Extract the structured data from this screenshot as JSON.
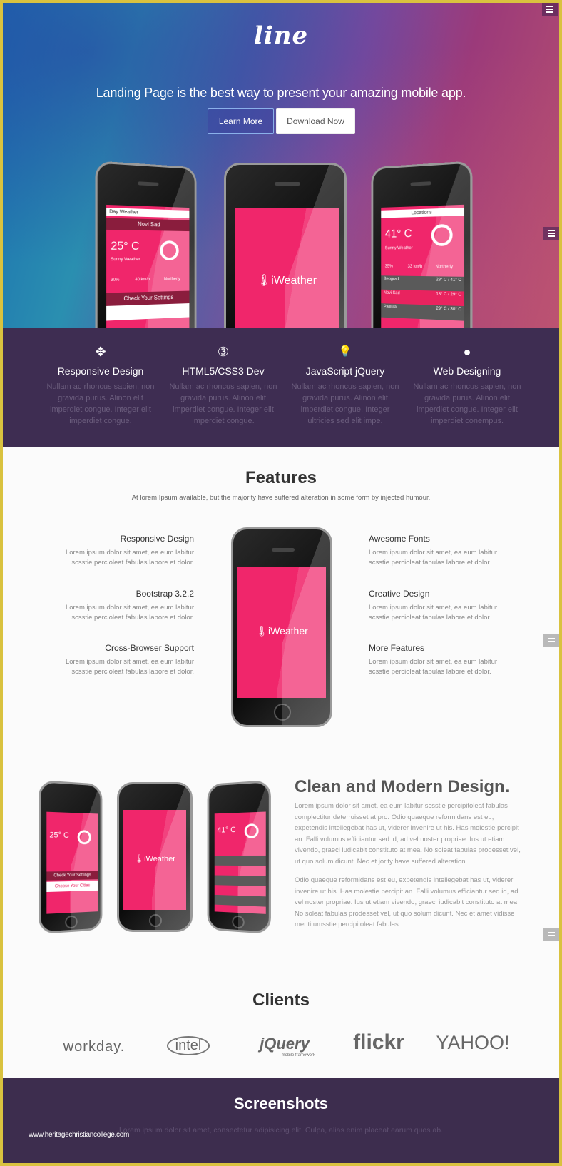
{
  "hero": {
    "logo": "line",
    "tagline": "Landing Page is the best way to present your amazing mobile app.",
    "learn_more": "Learn More",
    "download_now": "Download Now",
    "phones": {
      "left": {
        "app_title": "Day Weather",
        "city": "Novi Sad",
        "temp": "25° C",
        "condition": "Sunny Weather",
        "stats": [
          "30%",
          "40 km/h",
          "Northerly"
        ],
        "settings": "Check Your Settings"
      },
      "center": {
        "brand": "iWeather"
      },
      "right": {
        "app_title": "Locations",
        "temp": "41° C",
        "condition": "Sunny Weather",
        "stats": [
          "35%",
          "33 km/h",
          "Northerly"
        ],
        "rows": [
          {
            "city": "Beograd",
            "range": "28° C / 41° C"
          },
          {
            "city": "Novi Sad",
            "range": "18° C / 29° C"
          },
          {
            "city": "Palilula",
            "range": "29° C / 30° C"
          }
        ]
      }
    }
  },
  "services": [
    {
      "icon": "arrows-move-icon",
      "glyph": "✥",
      "title": "Responsive Design",
      "desc": "Nullam ac rhoncus sapien, non gravida purus. Alinon elit imperdiet congue. Integer elit imperdiet congue."
    },
    {
      "icon": "css3-icon",
      "glyph": "③",
      "title": "HTML5/CSS3 Dev",
      "desc": "Nullam ac rhoncus sapien, non gravida purus. Alinon elit imperdiet congue. Integer elit imperdiet congue."
    },
    {
      "icon": "lightbulb-icon",
      "glyph": "💡",
      "title": "JavaScript jQuery",
      "desc": "Nullam ac rhoncus sapien, non gravida purus. Alinon elit imperdiet congue. Integer ultricies sed elit impe."
    },
    {
      "icon": "globe-icon",
      "glyph": "●",
      "title": "Web Designing",
      "desc": "Nullam ac rhoncus sapien, non gravida purus. Alinon elit imperdiet congue. Integer elit imperdiet conempus."
    }
  ],
  "features": {
    "title": "Features",
    "subtitle": "At lorem Ipsum available, but the majority have suffered alteration in some form by injected humour.",
    "left": [
      {
        "title": "Responsive Design",
        "desc": "Lorem ipsum dolor sit amet, ea eum labitur scsstie percioleat fabulas labore et dolor."
      },
      {
        "title": "Bootstrap 3.2.2",
        "desc": "Lorem ipsum dolor sit amet, ea eum labitur scsstie percioleat fabulas labore et dolor."
      },
      {
        "title": "Cross-Browser Support",
        "desc": "Lorem ipsum dolor sit amet, ea eum labitur scsstie percioleat fabulas labore et dolor."
      }
    ],
    "right": [
      {
        "title": "Awesome Fonts",
        "desc": "Lorem ipsum dolor sit amet, ea eum labitur scsstie percioleat fabulas labore et dolor."
      },
      {
        "title": "Creative Design",
        "desc": "Lorem ipsum dolor sit amet, ea eum labitur scsstie percioleat fabulas labore et dolor."
      },
      {
        "title": "More Features",
        "desc": "Lorem ipsum dolor sit amet, ea eum labitur scsstie percioleat fabulas labore et dolor."
      }
    ],
    "phone_brand": "iWeather"
  },
  "modern": {
    "title": "Clean and Modern Design.",
    "p1": "Lorem ipsum dolor sit amet, ea eum labitur scsstie percipitoleat fabulas complectitur deterruisset at pro. Odio quaeque reformidans est eu, expetendis intellegebat has ut, viderer invenire ut his. Has molestie percipit an. Falli volumus efficiantur sed id, ad vel noster propriae. Ius ut etiam vivendo, graeci iudicabit constituto at mea. No soleat fabulas prodesset vel, ut quo solum dicunt. Nec et jority have suffered alteration.",
    "p2": "Odio quaeque reformidans est eu, expetendis intellegebat has ut, viderer invenire ut his. Has molestie percipit an. Falli volumus efficiantur sed id, ad vel noster propriae. Ius ut etiam vivendo, graeci iudicabit constituto at mea. No soleat fabulas prodesset vel, ut quo solum dicunt. Nec et amet vidisse mentitumsstie percipitoleat fabulas.",
    "phones": {
      "left_settings": "Check Your Settings",
      "left_choose": "Choose Your Cities",
      "center_brand": "iWeather",
      "right_temp": "41° C",
      "left_temp": "25° C"
    }
  },
  "clients": {
    "title": "Clients",
    "logos": [
      "workday.",
      "intel",
      "jQuery",
      "flickr",
      "YAHOO!"
    ],
    "jquery_sub": "mobile framework"
  },
  "screenshots": {
    "title": "Screenshots",
    "subtitle": "Lorem ipsum dolor sit amet, consectetur adipisicing elit. Culpa, alias enim placeat earum quos ab."
  },
  "watermark": "www.heritagechristiancollege.com"
}
